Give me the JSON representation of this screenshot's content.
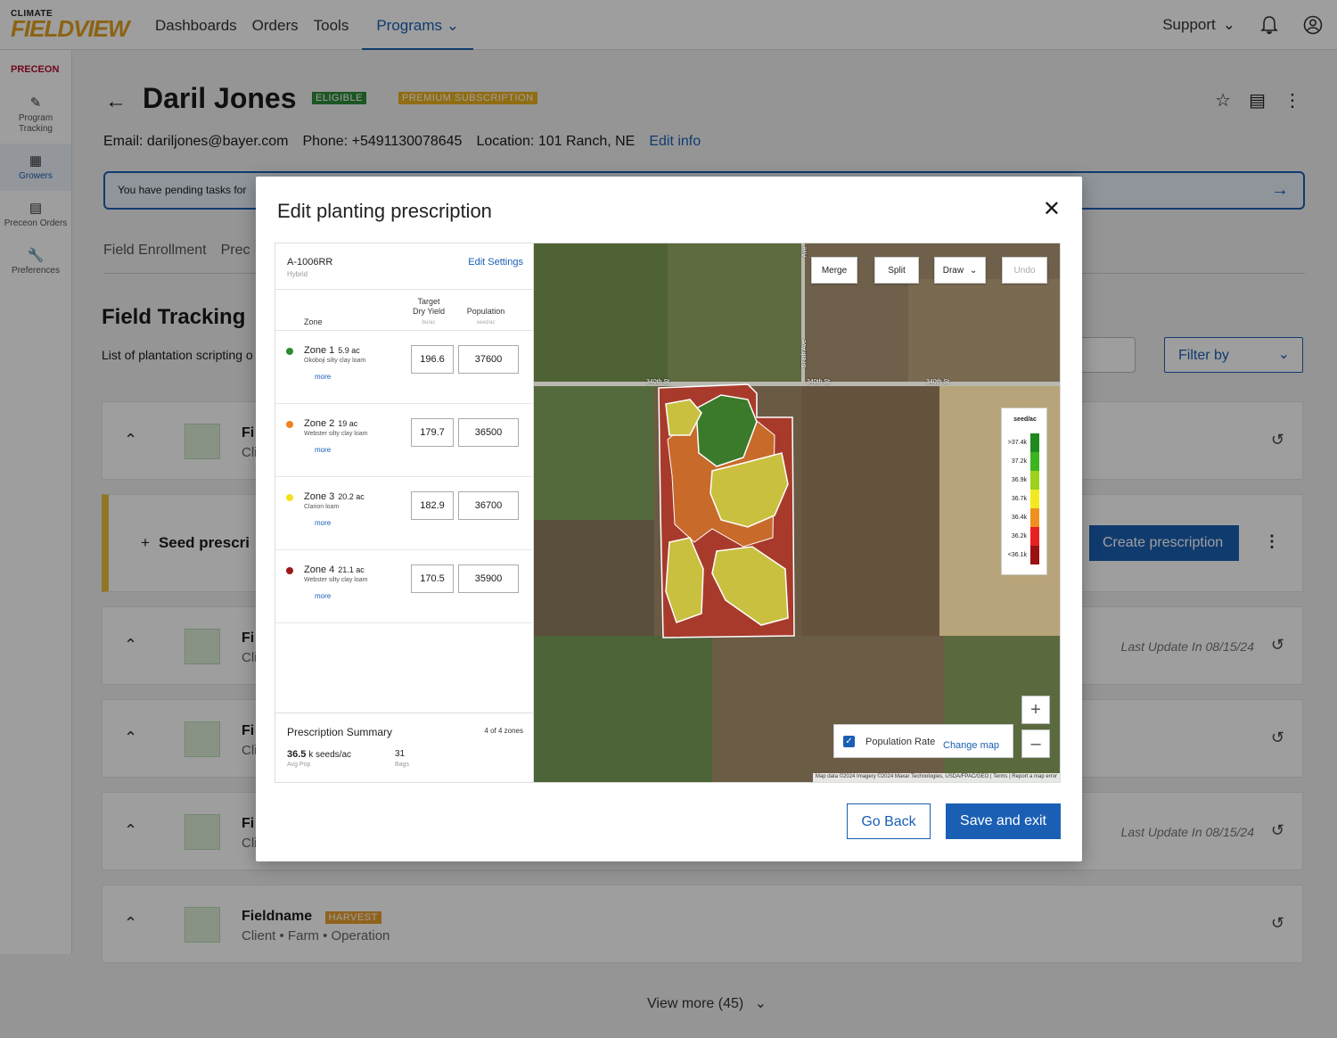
{
  "app": {
    "brand_top": "CLIMATE",
    "brand_main": "FIELDVIEW"
  },
  "nav": {
    "items": [
      "Dashboards",
      "Orders",
      "Tools"
    ],
    "active": "Programs",
    "support": "Support"
  },
  "sidebar": {
    "logo": "PRECEON",
    "items": [
      {
        "label": "Program Tracking",
        "icon": "clipboard-icon"
      },
      {
        "label": "Growers",
        "icon": "grid-icon"
      },
      {
        "label": "Preceon Orders",
        "icon": "document-icon"
      },
      {
        "label": "Preferences",
        "icon": "wrench-icon"
      }
    ]
  },
  "grower": {
    "name": "Daril Jones",
    "eligible": "ELIGIBLE",
    "premium": "PREMIUM SUBSCRIPTION",
    "email": "Email: dariljones@bayer.com",
    "phone": "Phone: +5491130078645",
    "location": "Location: 101 Ranch, NE",
    "edit_info": "Edit info"
  },
  "pending": "You have pending tasks for",
  "tabs": [
    "Field Enrollment",
    "Prec"
  ],
  "tracking": {
    "title": "Field Tracking",
    "subtitle": "List of plantation scripting o",
    "filter": "Filter by"
  },
  "cards": [
    {
      "name": "Fi",
      "meta": "Cli",
      "update": ""
    },
    {
      "seed_title": "Seed prescri",
      "create": "Create prescription"
    },
    {
      "name": "Fi",
      "meta": "Cli",
      "update": "Last Update In 08/15/24"
    },
    {
      "name": "Fi",
      "meta": "Cli",
      "update": ""
    },
    {
      "name": "Fi",
      "meta": "Cli",
      "update": "Last Update In 08/15/24"
    },
    {
      "name": "Fieldname",
      "meta": "Client • Farm • Operation",
      "update": "",
      "badge": "HARVEST"
    }
  ],
  "view_more": "View more (45)",
  "modal": {
    "title": "Edit planting prescription",
    "hybrid": {
      "name": "A-1006RR",
      "type": "Hybrid",
      "edit_settings": "Edit Settings"
    },
    "columns": {
      "zone": "Zone",
      "yield_line1": "Target",
      "yield_line2": "Dry Yield",
      "yield_unit": "bu/ac",
      "population": "Population",
      "population_unit": "seed/ac"
    },
    "zones": [
      {
        "name": "Zone 1",
        "acres": "5.9 ac",
        "soil": "Okoboji silty clay loam",
        "more": "more",
        "yield": "196.6",
        "population": "37600",
        "color": "#2e8b2e"
      },
      {
        "name": "Zone 2",
        "acres": "19 ac",
        "soil": "Webster silty clay loam",
        "more": "more",
        "yield": "179.7",
        "population": "36500",
        "color": "#f08020"
      },
      {
        "name": "Zone 3",
        "acres": "20.2 ac",
        "soil": "Clarion loam",
        "more": "more",
        "yield": "182.9",
        "population": "36700",
        "color": "#f5e020"
      },
      {
        "name": "Zone 4",
        "acres": "21.1 ac",
        "soil": "Webster silty clay loam",
        "more": "more",
        "yield": "170.5",
        "population": "35900",
        "color": "#9a1818"
      }
    ],
    "summary": {
      "title": "Prescription Summary",
      "count": "4 of 4 zones",
      "avg_pop_value": "36.5",
      "avg_pop_unit": "k seeds/ac",
      "avg_pop_label": "Avg Pop",
      "bags_value": "31",
      "bags_label": "Bags"
    },
    "map": {
      "tools": [
        "Merge",
        "Split",
        "Draw",
        "Undo"
      ],
      "roads": [
        "340th St",
        "340th St",
        "340th St",
        "578th Ave",
        "Ave"
      ],
      "legend_title": "seed/ac",
      "legend": [
        {
          "label": ">37.4k",
          "color": "#1e8a1e"
        },
        {
          "label": "37.2k",
          "color": "#3cb41e"
        },
        {
          "label": "36.9k",
          "color": "#9ad21e"
        },
        {
          "label": "36.7k",
          "color": "#f2ea1e"
        },
        {
          "label": "36.4k",
          "color": "#f09020"
        },
        {
          "label": "36.2k",
          "color": "#e82020"
        },
        {
          "label": "<36.1k",
          "color": "#9a1010"
        }
      ],
      "layer_label": "Population Rate",
      "change_map": "Change map",
      "attribution": "Map data ©2024 Imagery ©2024 Maxar Technologies, USDA/FPAC/GEO | Terms | Report a map error"
    },
    "go_back": "Go Back",
    "save_exit": "Save and exit"
  }
}
